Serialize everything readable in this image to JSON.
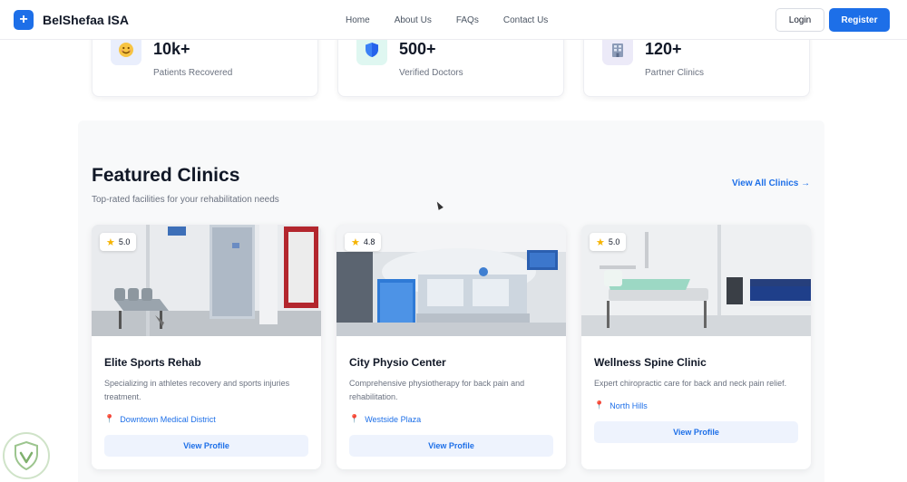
{
  "brand": {
    "logo_glyph": "+",
    "name": "BelShefaa ISA"
  },
  "nav": {
    "links": [
      "Home",
      "About Us",
      "FAQs",
      "Contact Us"
    ]
  },
  "auth": {
    "login": "Login",
    "register": "Register"
  },
  "stats": [
    {
      "icon": "smiley-icon",
      "value": "10k+",
      "label": "Patients Recovered"
    },
    {
      "icon": "shield-icon",
      "value": "500+",
      "label": "Verified Doctors"
    },
    {
      "icon": "clinic-building-icon",
      "value": "120+",
      "label": "Partner Clinics"
    }
  ],
  "featured": {
    "title": "Featured Clinics",
    "subtitle": "Top-rated facilities for your rehabilitation needs",
    "view_all": "View All Clinics →",
    "clinics": [
      {
        "rating": "5.0",
        "name": "Elite Sports Rehab",
        "description": "Specializing in athletes recovery and sports injuries treatment.",
        "location": "Downtown Medical District",
        "cta": "View Profile"
      },
      {
        "rating": "4.8",
        "name": "City Physio Center",
        "description": "Comprehensive physiotherapy for back pain and rehabilitation.",
        "location": "Westside Plaza",
        "cta": "View Profile"
      },
      {
        "rating": "5.0",
        "name": "Wellness Spine Clinic",
        "description": "Expert chiropractic care for back and neck pain relief.",
        "location": "North Hills",
        "cta": "View Profile"
      }
    ]
  },
  "colors": {
    "primary": "#1d6fe8",
    "star": "#f5b301",
    "pin": "#e53945",
    "section_bg": "#f8f9fa"
  }
}
